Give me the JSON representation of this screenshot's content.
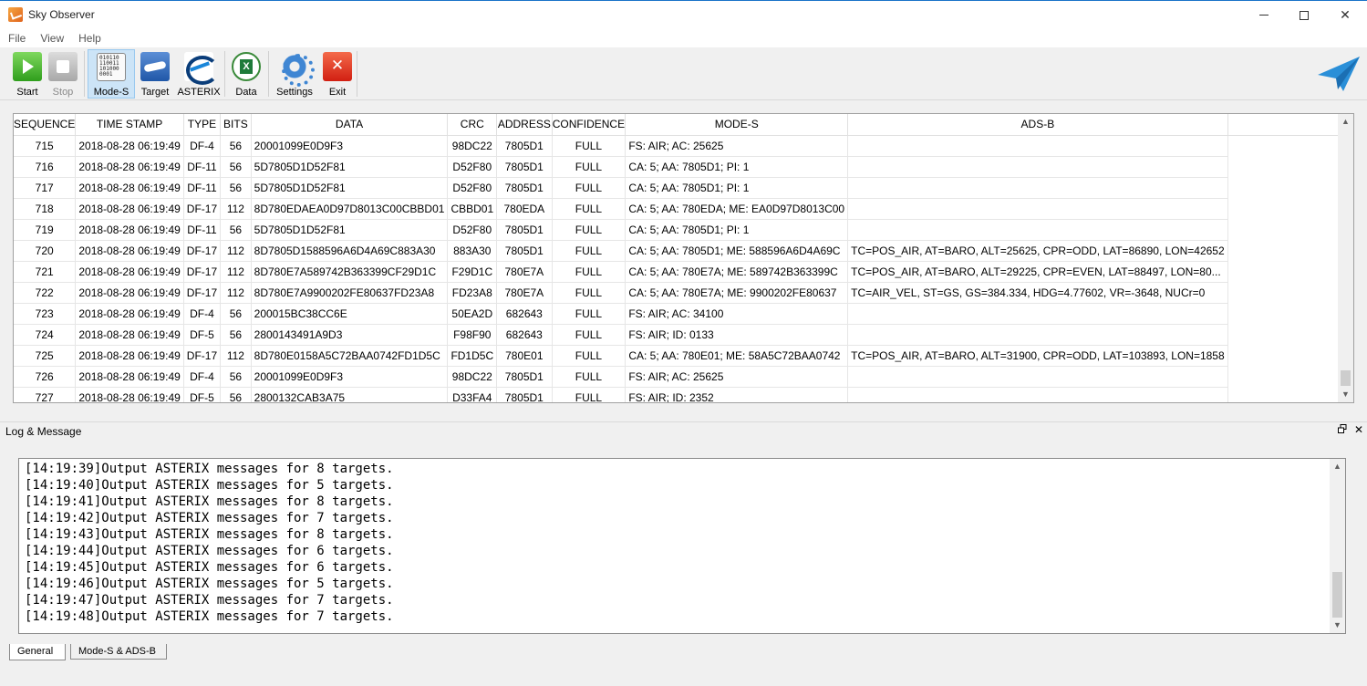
{
  "window": {
    "title": "Sky Observer"
  },
  "menu": [
    "File",
    "View",
    "Help"
  ],
  "toolbar": {
    "buttons": [
      {
        "label": "Start",
        "icon": "play-icon",
        "enabled": true,
        "active": false
      },
      {
        "label": "Stop",
        "icon": "stop-icon",
        "enabled": false,
        "active": false
      },
      {
        "label": "Mode-S",
        "icon": "binary-data-icon",
        "enabled": true,
        "active": true
      },
      {
        "label": "Target",
        "icon": "airplane-icon",
        "enabled": true,
        "active": false
      },
      {
        "label": "ASTERIX",
        "icon": "asterix-logo-icon",
        "enabled": true,
        "active": false
      },
      {
        "label": "Data",
        "icon": "excel-icon",
        "enabled": true,
        "active": false
      },
      {
        "label": "Settings",
        "icon": "gear-icon",
        "enabled": true,
        "active": false
      },
      {
        "label": "Exit",
        "icon": "exit-icon",
        "enabled": true,
        "active": false
      }
    ],
    "brand_icon": "paper-plane-icon"
  },
  "table": {
    "columns": [
      "SEQUENCE",
      "TIME STAMP",
      "TYPE",
      "BITS",
      "DATA",
      "CRC",
      "ADDRESS",
      "CONFIDENCE",
      "MODE-S",
      "ADS-B"
    ],
    "rows": [
      [
        "715",
        "2018-08-28 06:19:49",
        "DF-4",
        "56",
        "20001099E0D9F3",
        "98DC22",
        "7805D1",
        "FULL",
        "FS: AIR; AC: 25625",
        ""
      ],
      [
        "716",
        "2018-08-28 06:19:49",
        "DF-11",
        "56",
        "5D7805D1D52F81",
        "D52F80",
        "7805D1",
        "FULL",
        "CA: 5; AA: 7805D1; PI: 1",
        ""
      ],
      [
        "717",
        "2018-08-28 06:19:49",
        "DF-11",
        "56",
        "5D7805D1D52F81",
        "D52F80",
        "7805D1",
        "FULL",
        "CA: 5; AA: 7805D1; PI: 1",
        ""
      ],
      [
        "718",
        "2018-08-28 06:19:49",
        "DF-17",
        "112",
        "8D780EDAEA0D97D8013C00CBBD01",
        "CBBD01",
        "780EDA",
        "FULL",
        "CA: 5; AA: 780EDA; ME: EA0D97D8013C00",
        ""
      ],
      [
        "719",
        "2018-08-28 06:19:49",
        "DF-11",
        "56",
        "5D7805D1D52F81",
        "D52F80",
        "7805D1",
        "FULL",
        "CA: 5; AA: 7805D1; PI: 1",
        ""
      ],
      [
        "720",
        "2018-08-28 06:19:49",
        "DF-17",
        "112",
        "8D7805D1588596A6D4A69C883A30",
        "883A30",
        "7805D1",
        "FULL",
        "CA: 5; AA: 7805D1; ME: 588596A6D4A69C",
        "TC=POS_AIR, AT=BARO, ALT=25625, CPR=ODD, LAT=86890, LON=42652"
      ],
      [
        "721",
        "2018-08-28 06:19:49",
        "DF-17",
        "112",
        "8D780E7A589742B363399CF29D1C",
        "F29D1C",
        "780E7A",
        "FULL",
        "CA: 5; AA: 780E7A; ME: 589742B363399C",
        "TC=POS_AIR, AT=BARO, ALT=29225, CPR=EVEN, LAT=88497, LON=80..."
      ],
      [
        "722",
        "2018-08-28 06:19:49",
        "DF-17",
        "112",
        "8D780E7A9900202FE80637FD23A8",
        "FD23A8",
        "780E7A",
        "FULL",
        "CA: 5; AA: 780E7A; ME: 9900202FE80637",
        "TC=AIR_VEL, ST=GS, GS=384.334, HDG=4.77602, VR=-3648, NUCr=0"
      ],
      [
        "723",
        "2018-08-28 06:19:49",
        "DF-4",
        "56",
        "200015BC38CC6E",
        "50EA2D",
        "682643",
        "FULL",
        "FS: AIR; AC: 34100",
        ""
      ],
      [
        "724",
        "2018-08-28 06:19:49",
        "DF-5",
        "56",
        "2800143491A9D3",
        "F98F90",
        "682643",
        "FULL",
        "FS: AIR; ID: 0133",
        ""
      ],
      [
        "725",
        "2018-08-28 06:19:49",
        "DF-17",
        "112",
        "8D780E0158A5C72BAA0742FD1D5C",
        "FD1D5C",
        "780E01",
        "FULL",
        "CA: 5; AA: 780E01; ME: 58A5C72BAA0742",
        "TC=POS_AIR, AT=BARO, ALT=31900, CPR=ODD, LAT=103893, LON=1858"
      ],
      [
        "726",
        "2018-08-28 06:19:49",
        "DF-4",
        "56",
        "20001099E0D9F3",
        "98DC22",
        "7805D1",
        "FULL",
        "FS: AIR; AC: 25625",
        ""
      ],
      [
        "727",
        "2018-08-28 06:19:49",
        "DF-5",
        "56",
        "2800132CAB3A75",
        "D33FA4",
        "7805D1",
        "FULL",
        "FS: AIR; ID: 2352",
        ""
      ]
    ]
  },
  "log": {
    "title": "Log & Message",
    "lines": [
      "[14:19:39]Output ASTERIX messages for 8 targets.",
      "[14:19:40]Output ASTERIX messages for 5 targets.",
      "[14:19:41]Output ASTERIX messages for 8 targets.",
      "[14:19:42]Output ASTERIX messages for 7 targets.",
      "[14:19:43]Output ASTERIX messages for 8 targets.",
      "[14:19:44]Output ASTERIX messages for 6 targets.",
      "[14:19:45]Output ASTERIX messages for 6 targets.",
      "[14:19:46]Output ASTERIX messages for 5 targets.",
      "[14:19:47]Output ASTERIX messages for 7 targets.",
      "[14:19:48]Output ASTERIX messages for 7 targets."
    ]
  },
  "tabs": [
    {
      "label": "General",
      "active": true
    },
    {
      "label": "Mode-S & ADS-B",
      "active": false
    }
  ],
  "colors": {
    "accent": "#1a86d9",
    "active_button": "#cce4f7",
    "scroll_thumb": "#cdcdcd"
  }
}
